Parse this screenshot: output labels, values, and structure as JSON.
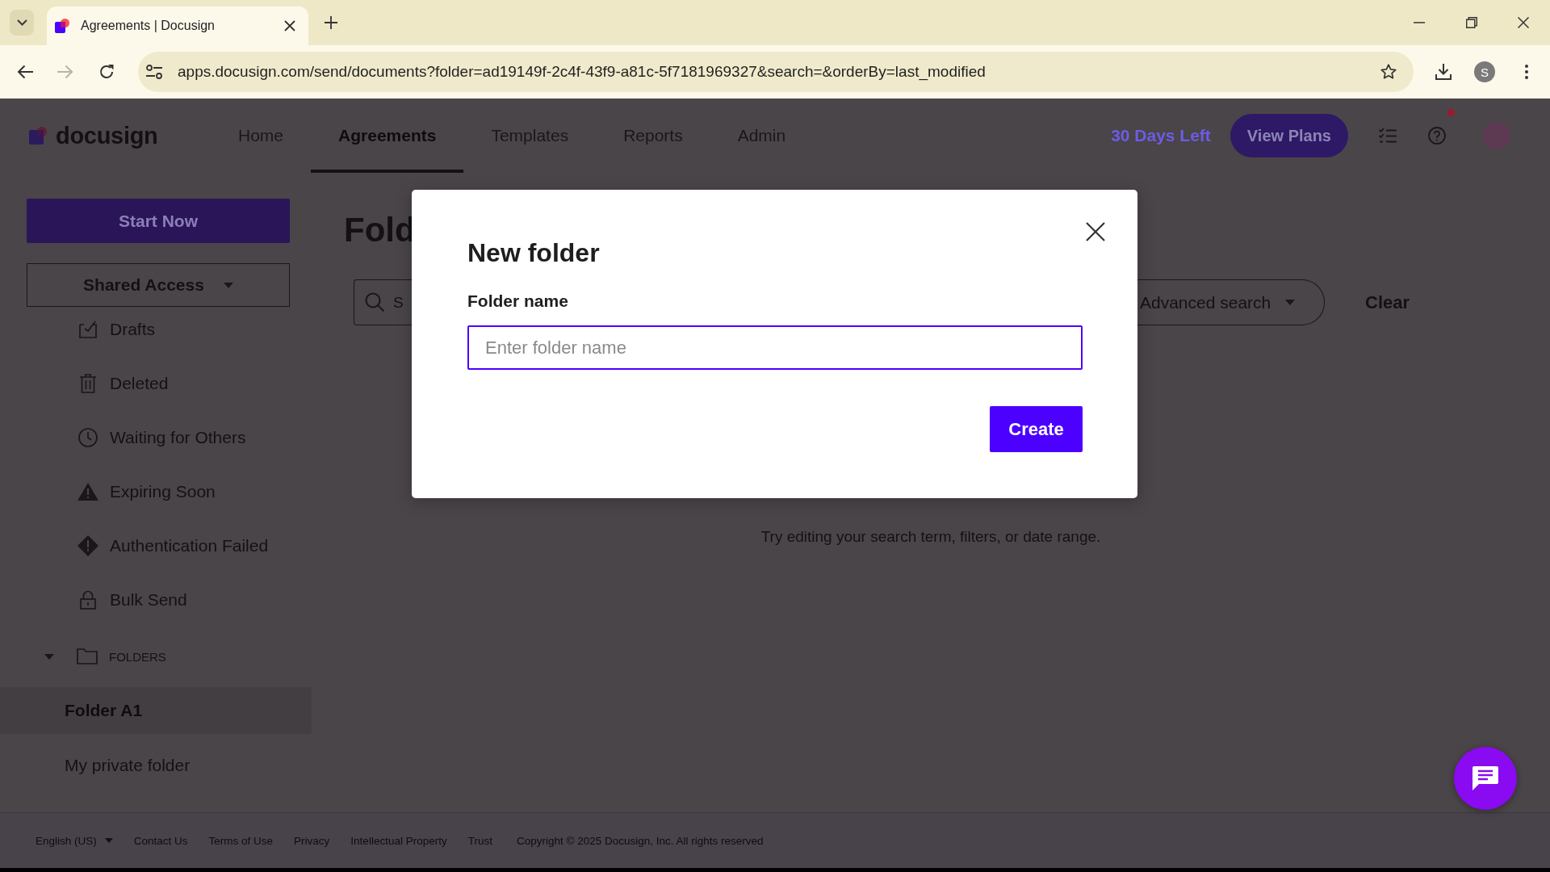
{
  "browser": {
    "tab": {
      "title": "Agreements | Docusign"
    },
    "forward": {
      "disabled": true
    },
    "url": "apps.docusign.com/send/documents?folder=ad19149f-2c4f-43f9-a81c-5f7181969327&search=&orderBy=last_modified",
    "profile": "S"
  },
  "header": {
    "logo": "docusign",
    "nav": [
      {
        "label": "Home",
        "selected": false
      },
      {
        "label": "Agreements",
        "selected": true
      },
      {
        "label": "Templates",
        "selected": false
      },
      {
        "label": "Reports",
        "selected": false
      },
      {
        "label": "Admin",
        "selected": false
      }
    ],
    "trial": "30 Days Left",
    "cta": "View Plans",
    "help": {
      "notification": true
    }
  },
  "sidebar": {
    "start_button": "Start Now",
    "dropdown": "Shared Access",
    "items": [
      {
        "label": "Drafts"
      },
      {
        "label": "Deleted"
      },
      {
        "label": "Waiting for Others"
      },
      {
        "label": "Expiring Soon"
      },
      {
        "label": "Authentication Failed"
      },
      {
        "label": "Bulk Send"
      }
    ],
    "folders": {
      "label": "FOLDERS",
      "expanded": true,
      "children": [
        {
          "label": "Folder A1",
          "selected": true
        },
        {
          "label": "My private folder",
          "selected": false
        }
      ]
    }
  },
  "main": {
    "heading": "Fold",
    "search": {
      "placeholder": "S"
    },
    "advanced_search": "Advanced search",
    "clear": "Clear",
    "empty_message": "Try editing your search term, filters, or date range."
  },
  "dialog": {
    "title": "New folder",
    "field": {
      "label": "Folder name",
      "placeholder": "Enter folder name"
    },
    "button": "Create"
  },
  "footer": {
    "language": "English (US)",
    "links": [
      "Contact Us",
      "Terms of Use",
      "Privacy",
      "Intellectual Property",
      "Trust"
    ],
    "copyright": "Copyright © 2025 Docusign, Inc. All rights reserved"
  }
}
